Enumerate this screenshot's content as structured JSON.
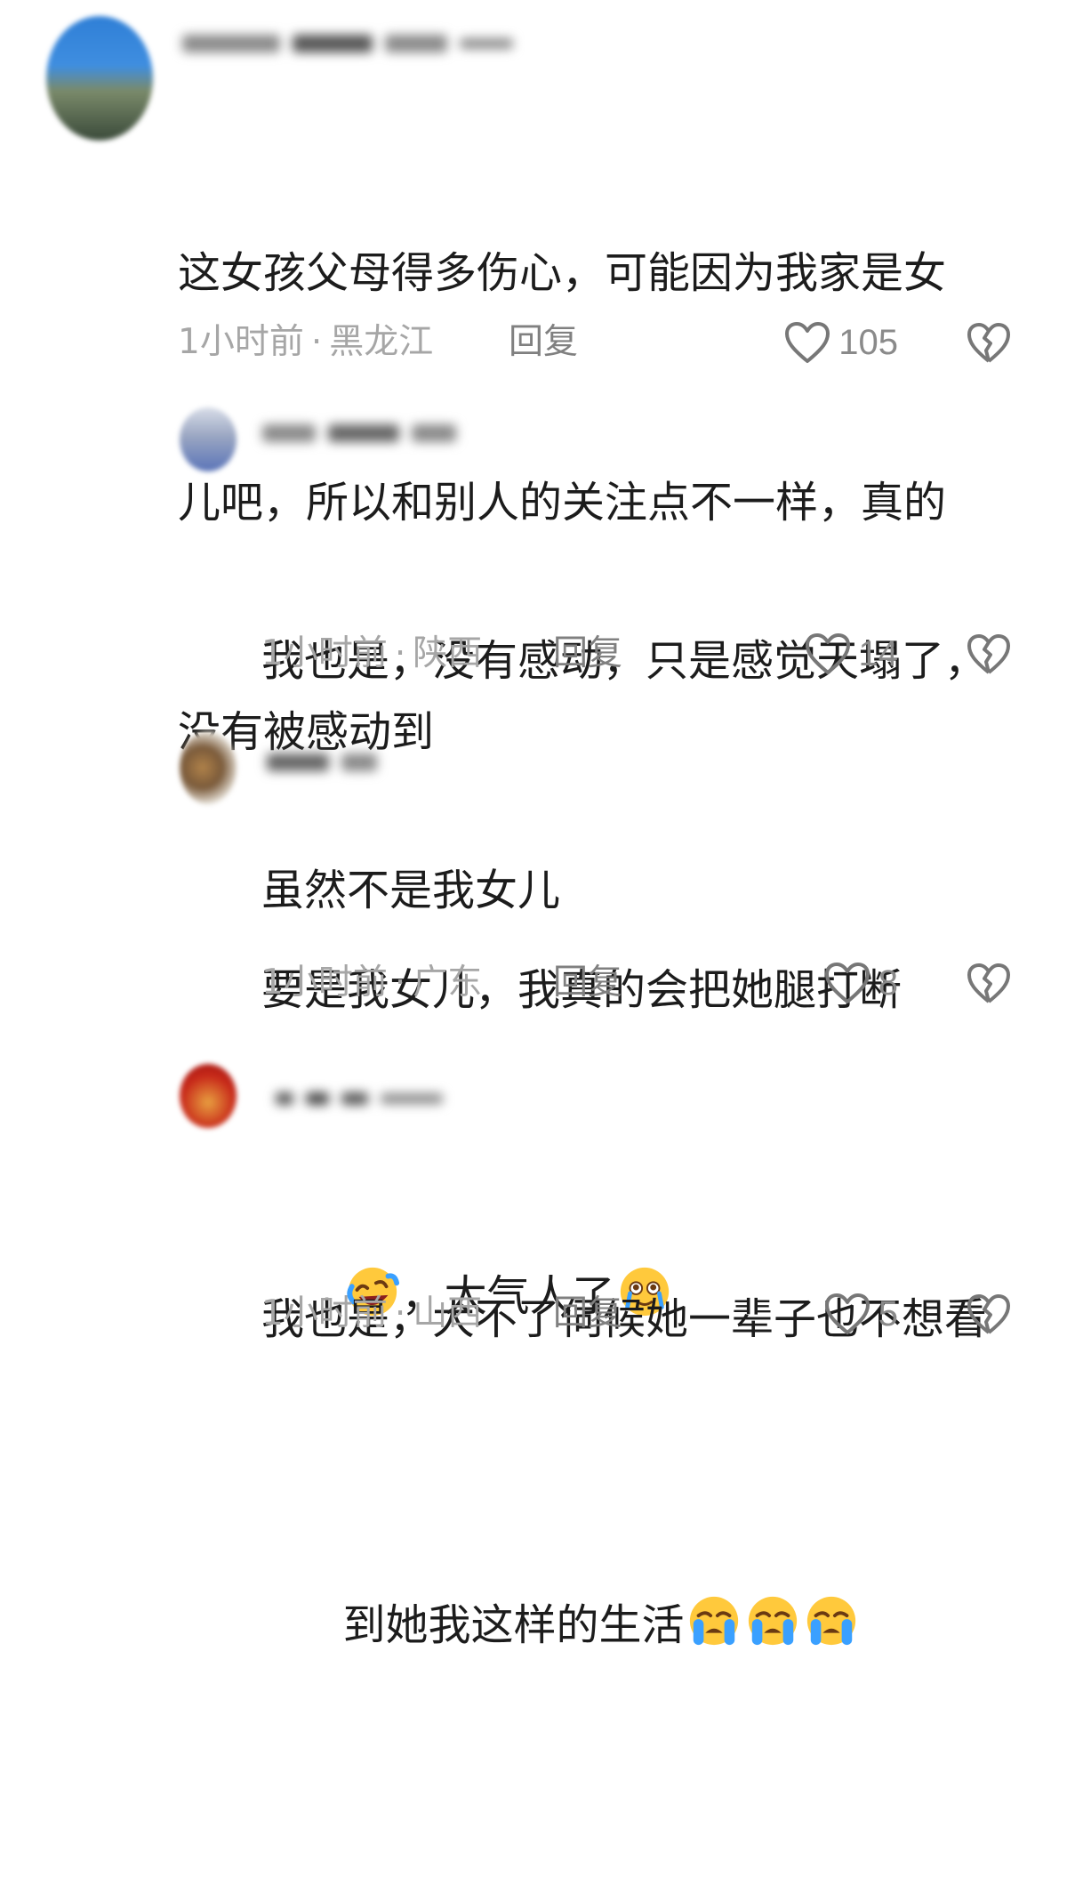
{
  "comments": [
    {
      "text_lines": [
        "这女孩父母得多伤心，可能因为我家是女",
        "儿吧，所以和别人的关注点不一样，真的",
        "没有被感动到"
      ],
      "time": "1小时前",
      "location": "黑龙江",
      "reply": "回复",
      "likes": "105"
    },
    {
      "text_lines": [
        "我也是，没有感动，只是感觉天塌了，",
        "虽然不是我女儿"
      ],
      "time": "1小时前",
      "location": "陕西",
      "reply": "回复",
      "likes": "14"
    },
    {
      "text_line1": "要是我女儿，我真的会把她腿打断",
      "text_line2_mid": "，太气人了",
      "time": "1小时前",
      "location": "广东",
      "reply": "回复",
      "likes": "8"
    },
    {
      "text_line1": "我也是，大不了伺候她一辈子也不想看",
      "text_line2": "到她我这样的生活",
      "time": "1小时前",
      "location": "山西",
      "reply": "回复",
      "likes": "5"
    }
  ],
  "meta_separator": "·",
  "icons": {
    "like": "heart-outline-icon",
    "dislike": "broken-heart-icon",
    "emoji_laugh_cry": "rolling-laughing-emoji",
    "emoji_teary": "teary-eyed-emoji",
    "emoji_crying": "loudly-crying-emoji"
  },
  "colors": {
    "text": "#1c1c1c",
    "meta": "#a6a6a6",
    "reply": "#808080",
    "icon": "#777777"
  }
}
